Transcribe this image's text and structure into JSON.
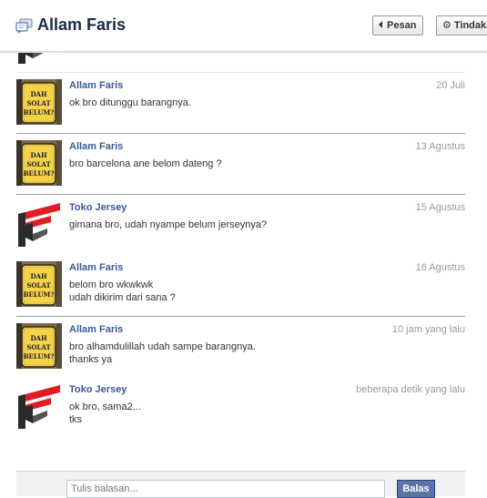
{
  "header": {
    "title": "Allam Faris",
    "title_icon": "messages-icon",
    "buttons": [
      {
        "label": "Pesan",
        "icon": "triangle-left-icon"
      },
      {
        "label": "Tindakan",
        "icon": "gear-icon"
      }
    ]
  },
  "avatars": {
    "allam": {
      "line1": "DAH",
      "line2": "SOLAT",
      "line3": "BELUM?"
    }
  },
  "messages": [
    {
      "sender": "Allam Faris",
      "time": "20 Juli",
      "lines": [
        "ok bro ditunggu barangnya."
      ]
    },
    {
      "sender": "Allam Faris",
      "time": "13 Agustus",
      "lines": [
        "bro barcelona ane belom dateng ?"
      ]
    },
    {
      "sender": "Toko Jersey",
      "time": "15 Agustus",
      "lines": [
        "gimana bro, udah nyampe belum jerseynya?"
      ]
    },
    {
      "sender": "Allam Faris",
      "time": "16 Agustus",
      "lines": [
        "belom bro wkwkwk",
        "udah dikirim dari sana ?"
      ]
    },
    {
      "sender": "Allam Faris",
      "time": "10 jam yang lalu",
      "lines": [
        "bro alhamdulillah udah sampe barangnya.",
        "thanks ya"
      ]
    },
    {
      "sender": "Toko Jersey",
      "time": "beberapa detik yang lalu",
      "lines": [
        "ok bro, sama2...",
        "tks"
      ]
    }
  ],
  "reply": {
    "placeholder": "Tulis balasan...",
    "button_label": "Balas"
  },
  "colors": {
    "link_blue": "#3b5998",
    "timestamp_gray": "#999999",
    "sign_yellow": "#f2d04a",
    "jersey_red": "#e21c24"
  }
}
